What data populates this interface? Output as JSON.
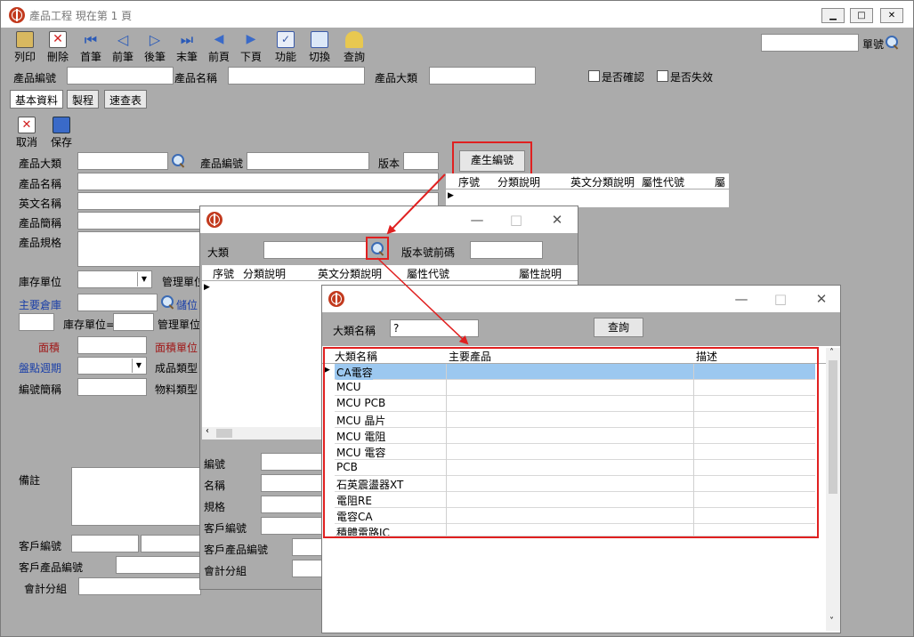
{
  "main": {
    "title": "產品工程  現在第 1 頁",
    "toolbar": [
      "列印",
      "刪除",
      "首筆",
      "前筆",
      "後筆",
      "末筆",
      "前頁",
      "下頁",
      "功能",
      "切換",
      "查詢"
    ],
    "search_label": "單號",
    "header": {
      "product_code": "產品編號",
      "product_name": "產品名稱",
      "category": "產品大類",
      "confirmed": "是否確認",
      "invalid": "是否失效"
    },
    "tabs": [
      "基本資料",
      "製程",
      "速查表"
    ],
    "actions": {
      "cancel": "取消",
      "save": "保存"
    },
    "form": {
      "category": "產品大類",
      "code": "產品編號",
      "version": "版本",
      "generate_button": "產生編號",
      "name": "產品名稱",
      "en_name": "英文名稱",
      "short_name": "產品簡稱",
      "spec": "產品規格",
      "stock_unit": "庫存單位",
      "mgmt_unit": "管理單位",
      "main_warehouse": "主要倉庫",
      "location": "儲位",
      "stock_unit_eq": "庫存單位=",
      "mgmt_unit2": "管理單位",
      "area": "面積",
      "area_unit": "面積單位",
      "cycle": "盤點週期",
      "finished_type": "成品類型",
      "code_short": "編號簡稱",
      "material_type": "物料類型",
      "remark": "備註",
      "customer_code": "客戶編號",
      "customer_product_code": "客戶產品編號",
      "account_group": "會計分組"
    },
    "right_grid_headers": [
      "序號",
      "分類說明",
      "英文分類說明",
      "屬性代號",
      "屬"
    ]
  },
  "dialog1": {
    "category_label": "大類",
    "prefix_label": "版本號前碼",
    "grid_headers": [
      "序號",
      "分類說明",
      "英文分類說明",
      "屬性代號",
      "屬性說明"
    ],
    "lower_labels": [
      "編號",
      "名稱",
      "規格",
      "客戶編號",
      "客戶產品編號",
      "會計分組"
    ]
  },
  "dialog2": {
    "name_label": "大類名稱",
    "name_value": "?",
    "query_button": "查詢",
    "grid_headers": [
      "大類名稱",
      "主要產品",
      "描述"
    ],
    "rows": [
      "CA電容",
      "MCU",
      "MCU PCB",
      "MCU 晶片",
      "MCU 電阻",
      "MCU 電容",
      "PCB",
      "石英震盪器XT",
      "電阻RE",
      "電容CA",
      "積體電路IC"
    ]
  },
  "colors": {
    "highlight": "#e02020",
    "selection": "#9cc8f0",
    "blue_label": "#1a3fa8",
    "red_label": "#a01818"
  }
}
